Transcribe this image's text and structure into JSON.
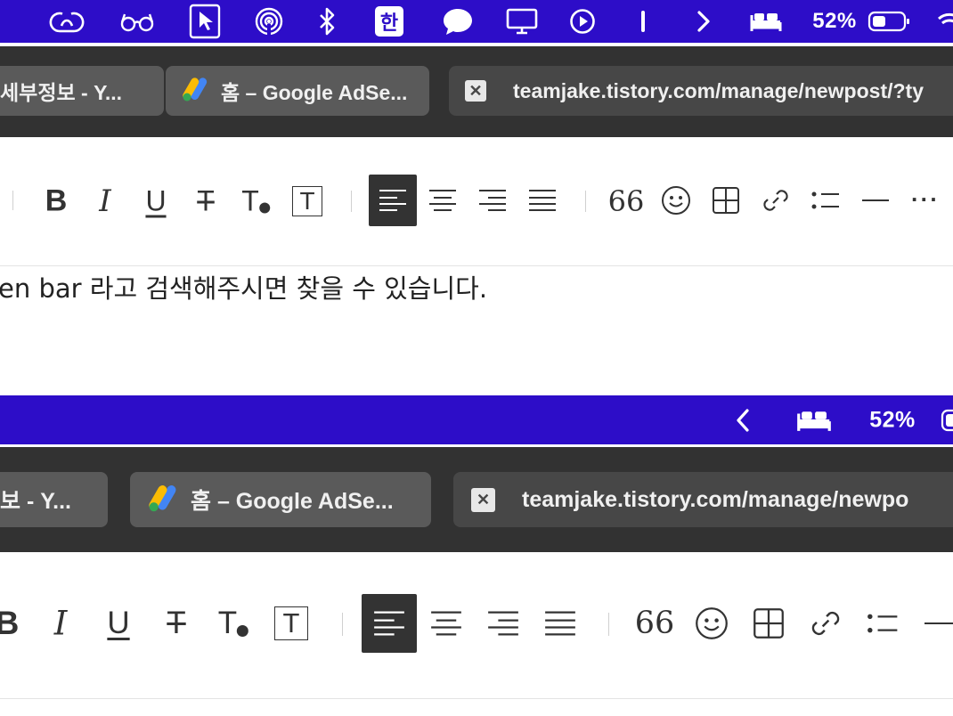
{
  "top": {
    "menubar": {
      "icons": [
        "creative-cloud-icon",
        "glasses-icon",
        "cursor-select-icon",
        "airdrop-icon",
        "bluetooth-icon",
        "input-source-icon",
        "chat-bubble-icon",
        "display-icon",
        "play-circle-icon",
        "vertical-bar-icon",
        "chevron-right-icon",
        "bed-icon",
        "battery-icon",
        "wifi-icon"
      ],
      "input_source_label": "한",
      "battery_percent": "52%",
      "bg_color": "#2d0dc8"
    },
    "tabs": [
      {
        "title": "세부정보 - Y..."
      },
      {
        "title": "홈 – Google AdSe..."
      },
      {
        "title": "teamjake.tistory.com/manage/newpost/?ty"
      }
    ],
    "body_text": "en bar 라고 검색해주시면 찾을 수 있습니다."
  },
  "bottom": {
    "menubar": {
      "icons": [
        "chevron-left-icon",
        "bed-icon",
        "battery-icon"
      ],
      "battery_percent": "52%"
    },
    "tabs": [
      {
        "title": "보 - Y..."
      },
      {
        "title": "홈 – Google AdSe..."
      },
      {
        "title": "teamjake.tistory.com/manage/newpo"
      }
    ]
  },
  "toolbar": {
    "bold_glyph": "B",
    "italic_glyph": "I",
    "underline_glyph": "U",
    "strike_glyph": "T",
    "text_color_glyph": "T",
    "text_bg_glyph": "T",
    "quote_glyph": "66",
    "more_glyph": "···"
  }
}
